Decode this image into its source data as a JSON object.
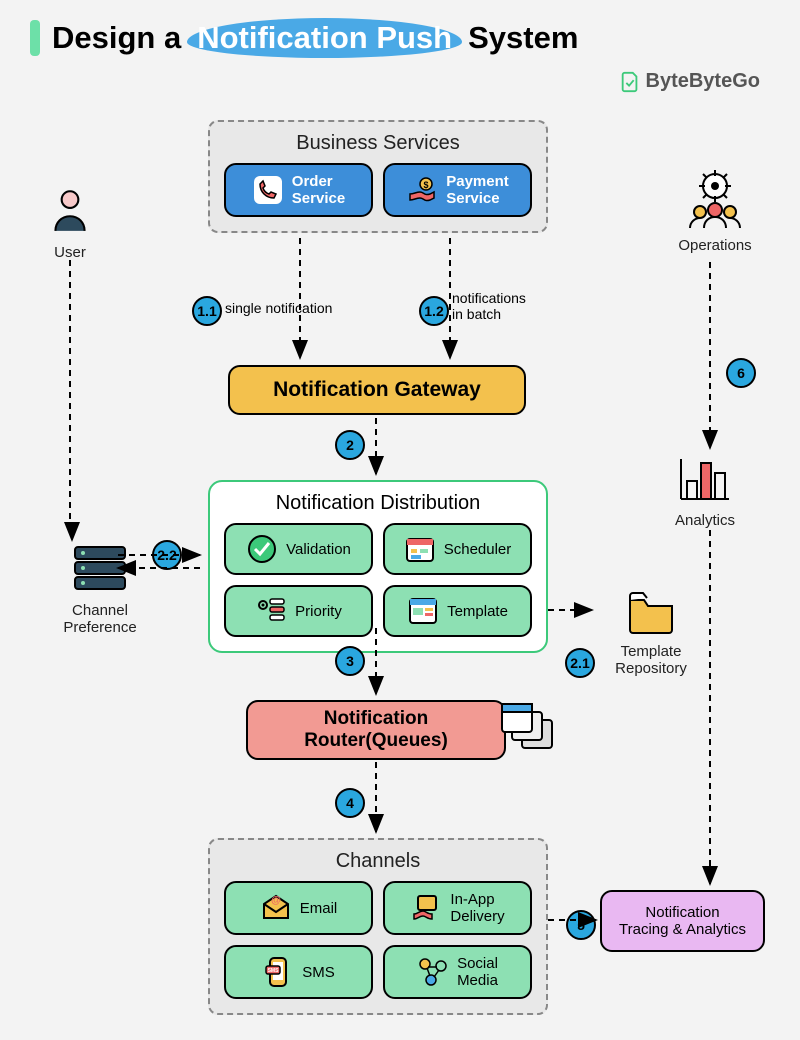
{
  "title": {
    "pre": "Design a ",
    "highlight": "Notification Push",
    "post": "System"
  },
  "brand": "ByteByteGo",
  "actors": {
    "user": "User",
    "ops": "Operations",
    "analytics": "Analytics",
    "channel_pref": "Channel\nPreference",
    "template_repo": "Template\nRepository"
  },
  "business": {
    "title": "Business Services",
    "order": "Order\nService",
    "payment": "Payment\nService"
  },
  "gateway": "Notification Gateway",
  "distribution": {
    "title": "Notification Distribution",
    "validation": "Validation",
    "scheduler": "Scheduler",
    "priority": "Priority",
    "template": "Template"
  },
  "router": "Notification\nRouter(Queues)",
  "channels": {
    "title": "Channels",
    "email": "Email",
    "inapp": "In-App\nDelivery",
    "sms": "SMS",
    "social": "Social\nMedia"
  },
  "tracing": "Notification\nTracing & Analytics",
  "edges": {
    "e11": "single notification",
    "e12": "notifications\nin batch"
  },
  "steps": {
    "s11": "1.1",
    "s12": "1.2",
    "s2": "2",
    "s21": "2.1",
    "s22": "2.2",
    "s3": "3",
    "s4": "4",
    "s5": "5",
    "s6": "6"
  }
}
